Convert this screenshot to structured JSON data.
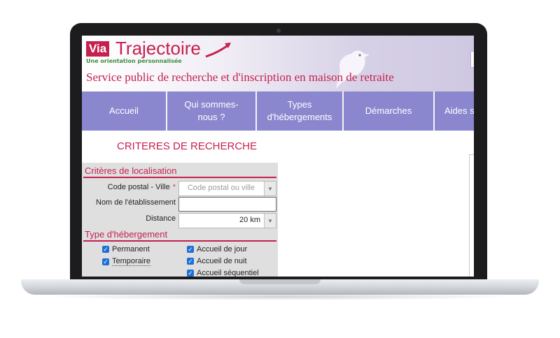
{
  "header": {
    "logo_via": "Via",
    "logo_traj": "Trajectoire",
    "logo_tagline": "Une orientation personnalisée",
    "tagline": "Service public de recherche et d'inscription en maison de retraite"
  },
  "nav": [
    {
      "label": "Accueil"
    },
    {
      "label": "Qui sommes-nous ?"
    },
    {
      "label": "Types d'hébergements"
    },
    {
      "label": "Démarches"
    },
    {
      "label": "Aides s"
    }
  ],
  "criteria_title": "CRITERES DE RECHERCHE",
  "localisation": {
    "title": "Critères de localisation",
    "postal_label": "Code postal - Ville",
    "required_mark": "*",
    "postal_placeholder": "Code postal ou ville",
    "name_label": "Nom de l'établissement",
    "name_value": "",
    "distance_label": "Distance",
    "distance_value": "20 km"
  },
  "hebergement": {
    "title": "Type d'hébergement",
    "options": [
      {
        "label": "Permanent",
        "checked": true
      },
      {
        "label": "Temporaire",
        "checked": true
      },
      {
        "label": "Accueil de jour",
        "checked": true
      },
      {
        "label": "Accueil de nuit",
        "checked": true
      },
      {
        "label": "Accueil séquentiel",
        "checked": true
      }
    ]
  },
  "icons": {
    "checkbox": "check-icon",
    "dropdown": "chevron-down-icon"
  },
  "colors": {
    "brand": "#c6204f",
    "nav": "#8b87cf",
    "green": "#3f8d3c",
    "checkbox": "#1f6fd6"
  }
}
